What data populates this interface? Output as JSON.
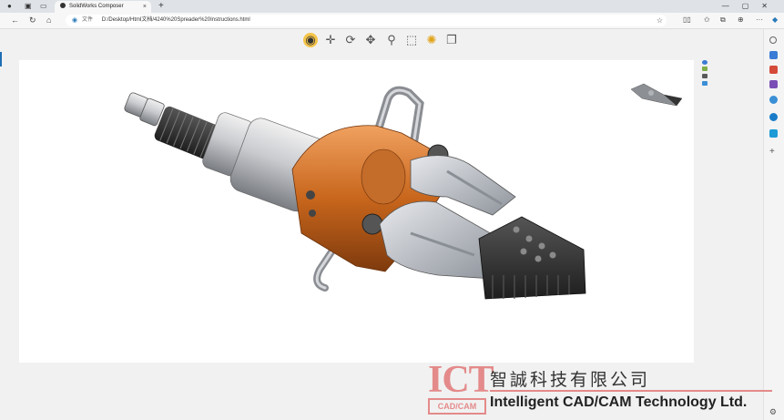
{
  "browser": {
    "tab_title": "SolidWorks Composer",
    "new_tab_symbol": "+",
    "tab_close_symbol": "×",
    "site_label": "文件",
    "url": "D:/Desktop/Html文档/4240%20Spreader%20Instructions.html"
  },
  "toolbar": {
    "tools": [
      "eye-icon",
      "pan-move-icon",
      "rotate-icon",
      "translate-icon",
      "zoom-icon",
      "zoom-box-icon",
      "light-bulb-icon",
      "view-cube-icon"
    ]
  },
  "watermark": {
    "logo_letters": "ICT",
    "logo_sub": "CAD/CAM",
    "company_cn": "智誠科技有限公司",
    "company_en": "Intelligent CAD/CAM Technology Ltd."
  },
  "colors": {
    "accent_orange": "#c8661c",
    "brand_pink": "#e48a8a"
  }
}
